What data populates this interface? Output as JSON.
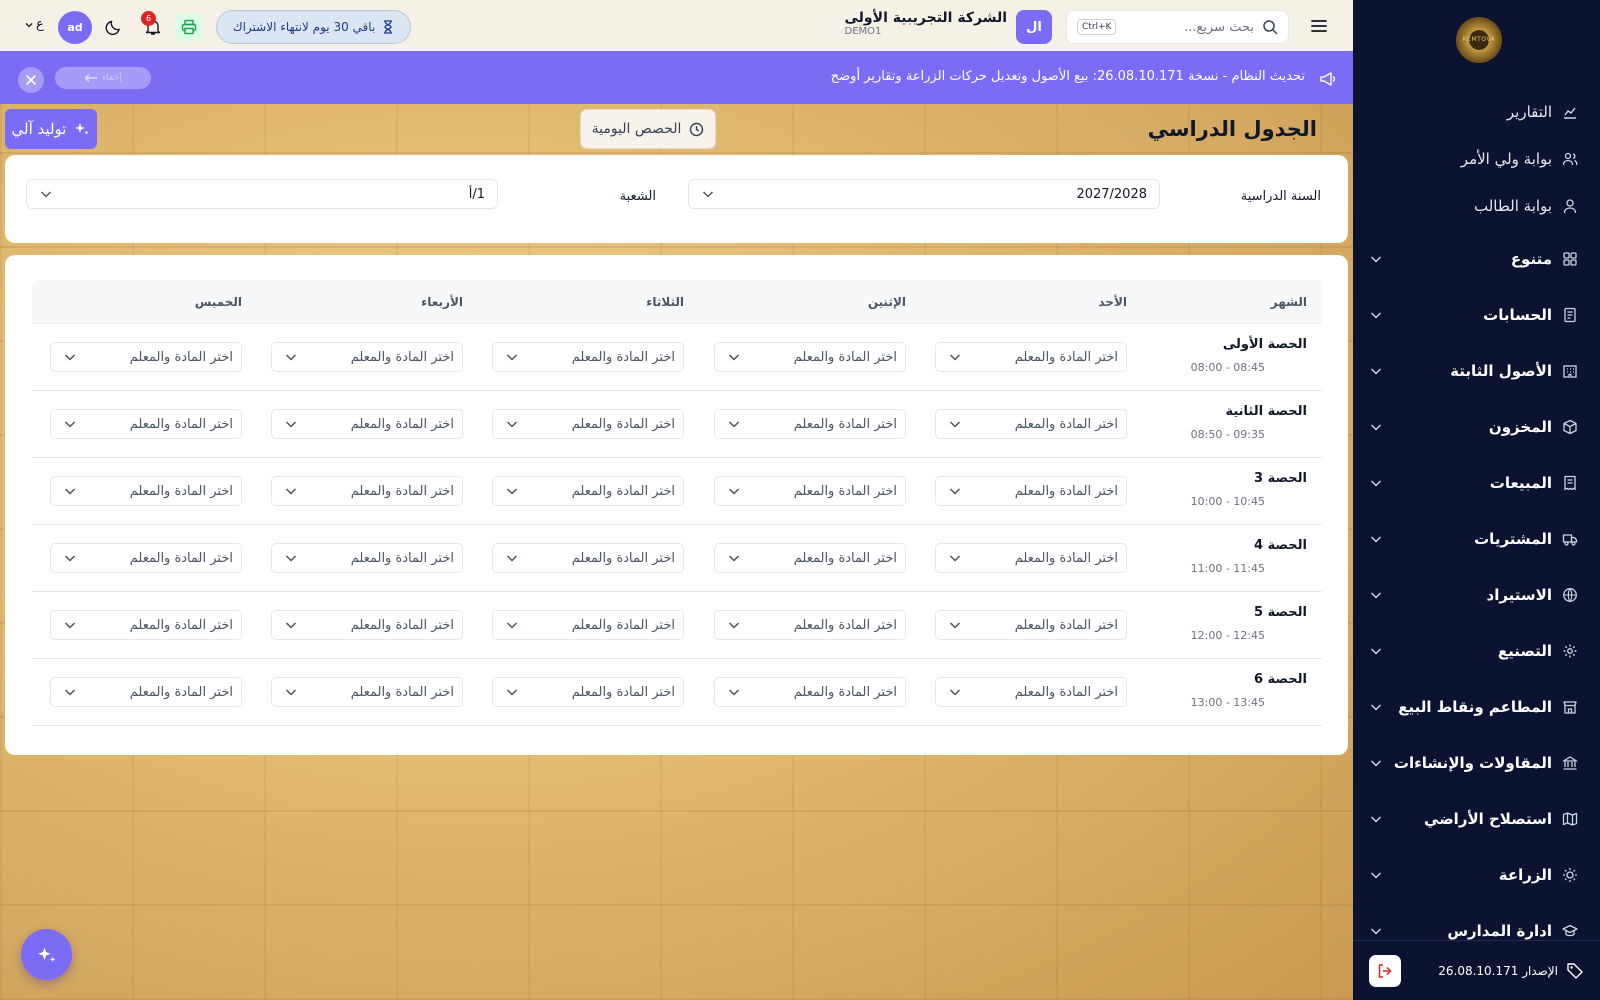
{
  "colors": {
    "accent": "#7b6cf6",
    "sidebar": "#0c1330",
    "badge": "#dc2626"
  },
  "sidebar": {
    "logo_text": "KEMTOVA",
    "simple_items": [
      {
        "label": "التقارير",
        "icon": "chart-icon"
      },
      {
        "label": "بوابة ولي الأمر",
        "icon": "users-icon"
      },
      {
        "label": "بوابة الطالب",
        "icon": "user-icon"
      }
    ],
    "groups": [
      {
        "label": "متنوع",
        "icon": "grid-icon"
      },
      {
        "label": "الحسابات",
        "icon": "ledger-icon"
      },
      {
        "label": "الأصول الثابتة",
        "icon": "building-icon"
      },
      {
        "label": "المخزون",
        "icon": "box-icon"
      },
      {
        "label": "المبيعات",
        "icon": "receipt-icon"
      },
      {
        "label": "المشتريات",
        "icon": "truck-icon"
      },
      {
        "label": "الاستيراد",
        "icon": "globe-icon"
      },
      {
        "label": "التصنيع",
        "icon": "gear-icon"
      },
      {
        "label": "المطاعم ونقاط البيع",
        "icon": "store-icon"
      },
      {
        "label": "المقاولات والإنشاءات",
        "icon": "bank-icon"
      },
      {
        "label": "استصلاح الأراضي",
        "icon": "map-icon"
      },
      {
        "label": "الزراعة",
        "icon": "sun-icon"
      },
      {
        "label": "ادارة المدارس",
        "icon": "school-icon"
      }
    ],
    "version": "الإصدار 26.08.10.171"
  },
  "topbar": {
    "search_placeholder": "بحث سريع...",
    "shortcut": "Ctrl+K",
    "company_initial": "ال",
    "company_name": "الشركة التجريبية الأولى",
    "company_code": "DEMO1",
    "trial_text": "باقي 30 يوم لانتهاء الاشتراك",
    "notifications_count": "6",
    "user_initials": "ad",
    "language": "ع"
  },
  "announcement": {
    "text": "تحديث النظام - نسخة 26.08.10.171: بيع الأصول وتعديل حركات الزراعة وتقارير أوضح",
    "hide_label": "إخفاء"
  },
  "page": {
    "title": "الجدول الدراسي",
    "daily_button": "الحصص اليومية",
    "auto_button": "توليد آلي"
  },
  "filters": {
    "year_label": "السنة الدراسية",
    "year_value": "2027/2028",
    "section_label": "الشعبة",
    "section_value": "1/أ"
  },
  "table": {
    "headers": [
      "الشهر",
      "الأحد",
      "الإثنين",
      "الثلاثاء",
      "الأربعاء",
      "الخميس"
    ],
    "cell_placeholder": "اختر المادة والمعلم",
    "periods": [
      {
        "name": "الحصة الأولى",
        "time": "08:00 - 08:45"
      },
      {
        "name": "الحصة الثانية",
        "time": "08:50 - 09:35"
      },
      {
        "name": "الحصة 3",
        "time": "10:00 - 10:45"
      },
      {
        "name": "الحصة 4",
        "time": "11:00 - 11:45"
      },
      {
        "name": "الحصة 5",
        "time": "12:00 - 12:45"
      },
      {
        "name": "الحصة 6",
        "time": "13:00 - 13:45"
      }
    ]
  }
}
